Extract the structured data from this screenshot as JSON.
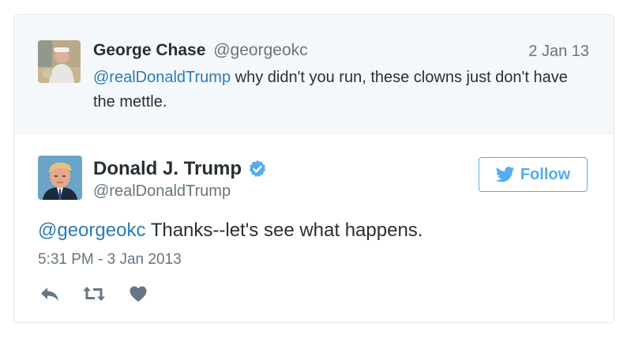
{
  "parent_tweet": {
    "display_name": "George Chase",
    "handle": "@georgeokc",
    "date": "2 Jan 13",
    "mention": "@realDonaldTrump",
    "text": " why didn't you run, these clowns just don't have the mettle."
  },
  "main_tweet": {
    "display_name": "Donald J. Trump",
    "handle": "@realDonaldTrump",
    "verified": true,
    "follow_label": "Follow",
    "mention": "@georgeokc",
    "text": " Thanks--let's see what happens.",
    "timestamp": "5:31 PM - 3 Jan 2013"
  },
  "actions": [
    "reply-icon",
    "retweet-icon",
    "like-icon"
  ],
  "colors": {
    "accent": "#55acee",
    "link": "#2b7bb9",
    "muted": "#66757f",
    "text": "#292f33",
    "parent_bg": "#f5f8fa",
    "action_icon": "#657786"
  }
}
